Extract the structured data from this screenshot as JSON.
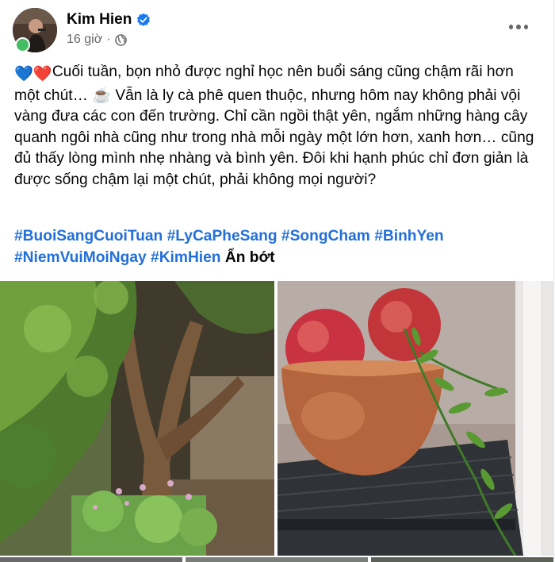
{
  "post": {
    "author": "Kim Hien",
    "time": "16 giờ",
    "body_text": "Cuối tuần, bọn nhỏ được nghỉ học nên buổi sáng cũng chậm rãi hơn một chút… ☕ Vẫn là ly cà phê quen thuộc, nhưng hôm nay không phải vội vàng đưa các con đến trường. Chỉ cần ngồi thật yên, ngắm những hàng cây quanh ngôi nhà cũng như trong nhà mỗi ngày một lớn hơn, xanh hơn… cũng đủ thấy lòng mình nhẹ nhàng và bình yên. Đôi khi hạnh phúc chỉ đơn giản là được sống chậm lại một chút, phải không mọi người?",
    "emoji_blue_heart": "💙",
    "emoji_red_heart": "❤️",
    "hashtags": [
      "#BuoiSangCuoiTuan",
      "#LyCaPheSang",
      "#SongCham",
      "#BinhYen",
      "#NiemVuiMoiNgay",
      "#KimHien"
    ],
    "see_less": "Ẩn bớt"
  },
  "icons": {
    "verified": "verified-badge-icon",
    "audience": "globe-icon",
    "more": "more-options-icon"
  },
  "colors": {
    "hashtag": "#216fdb",
    "verified": "#1877f2",
    "meta": "#65676b"
  }
}
